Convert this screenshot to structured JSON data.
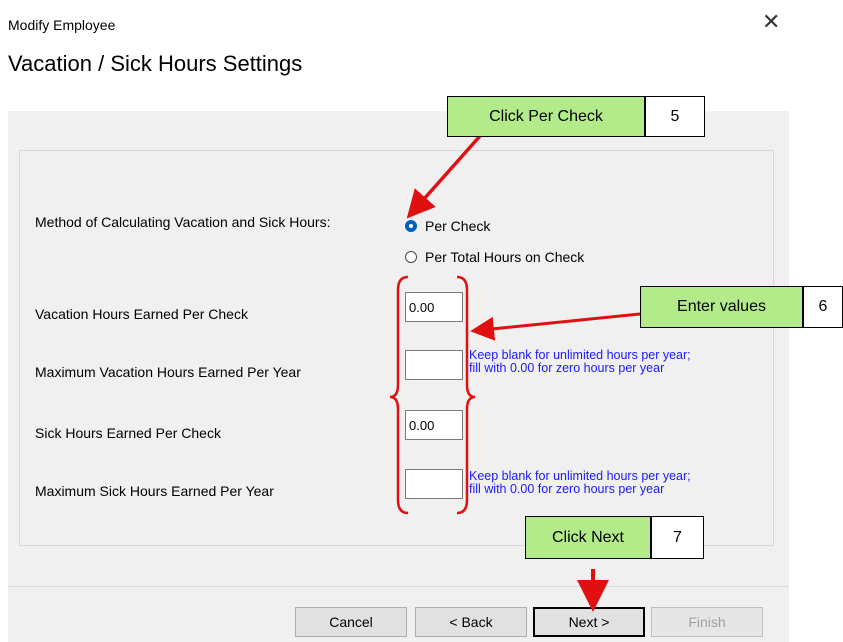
{
  "dialog": {
    "title": "Modify Employee",
    "close_glyph": "✕"
  },
  "page_title": "Vacation / Sick Hours Settings",
  "method": {
    "label": "Method of Calculating Vacation and Sick Hours:",
    "options": [
      {
        "label": "Per Check",
        "checked": true
      },
      {
        "label": "Per Total Hours on Check",
        "checked": false
      }
    ]
  },
  "fields": [
    {
      "label": "Vacation Hours Earned Per Check",
      "value": "0.00"
    },
    {
      "label": "Maximum Vacation Hours Earned Per Year",
      "value": "",
      "hint": [
        "Keep blank for unlimited hours per year;",
        "fill with 0.00 for zero hours per year"
      ]
    },
    {
      "label": "Sick Hours Earned Per Check",
      "value": "0.00"
    },
    {
      "label": "Maximum Sick Hours Earned Per Year",
      "value": "",
      "hint": [
        "Keep blank for unlimited hours per year;",
        "fill with 0.00 for zero hours per year"
      ]
    }
  ],
  "buttons": {
    "cancel": "Cancel",
    "back": "< Back",
    "next": "Next >",
    "finish": "Finish",
    "finish_enabled": false
  },
  "annotations": {
    "colors": {
      "callout_fill": "#b3ea8a",
      "annotation_red": "#e01010",
      "hint_blue": "#1a1aff"
    },
    "steps": [
      {
        "text": "Click Per Check",
        "number": "5"
      },
      {
        "text": "Enter values",
        "number": "6"
      },
      {
        "text": "Click Next",
        "number": "7"
      }
    ]
  }
}
